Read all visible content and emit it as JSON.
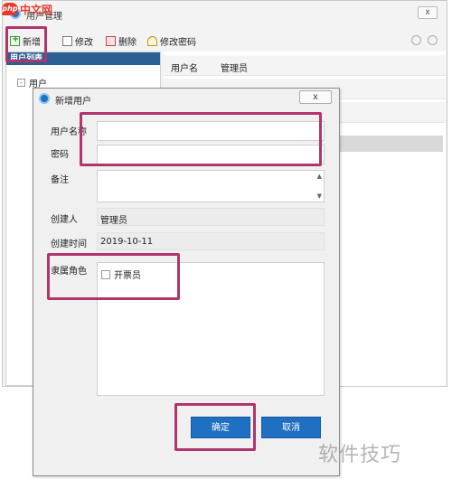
{
  "logo": {
    "badge": "php",
    "name": "中文网",
    "color": "#e63a2f"
  },
  "bg_window": {
    "title": "用户管理",
    "toolbar": [
      {
        "label": "新增",
        "icon": "add-icon"
      },
      {
        "label": "修改",
        "icon": "edit-icon"
      },
      {
        "label": "删除",
        "icon": "delete-icon"
      },
      {
        "label": "修改密码",
        "icon": "key-icon"
      }
    ],
    "list_header": "用户列表",
    "tree_item": "用户",
    "tree_expander": "-",
    "properties": [
      {
        "key": "用户名",
        "value": "管理员"
      },
      {
        "key": "",
        "value": ""
      },
      {
        "key": "",
        "value": ""
      }
    ],
    "close": "x"
  },
  "dialog": {
    "title": "新增用户",
    "close": "x",
    "labels": {
      "username": "用户名称",
      "password": "密码",
      "remark": "备注",
      "creator": "创建人",
      "created_time": "创建时间",
      "role": "隶属角色"
    },
    "values": {
      "username": "",
      "password": "",
      "remark": "",
      "creator": "管理员",
      "created_time": "2019-10-11"
    },
    "roles": [
      {
        "label": "开票员",
        "checked": false
      }
    ],
    "buttons": {
      "ok": "确定",
      "cancel": "取消"
    }
  },
  "highlight_color": "#b0356a",
  "accent_color": "#1f6fc2",
  "watermark": "软件技巧"
}
